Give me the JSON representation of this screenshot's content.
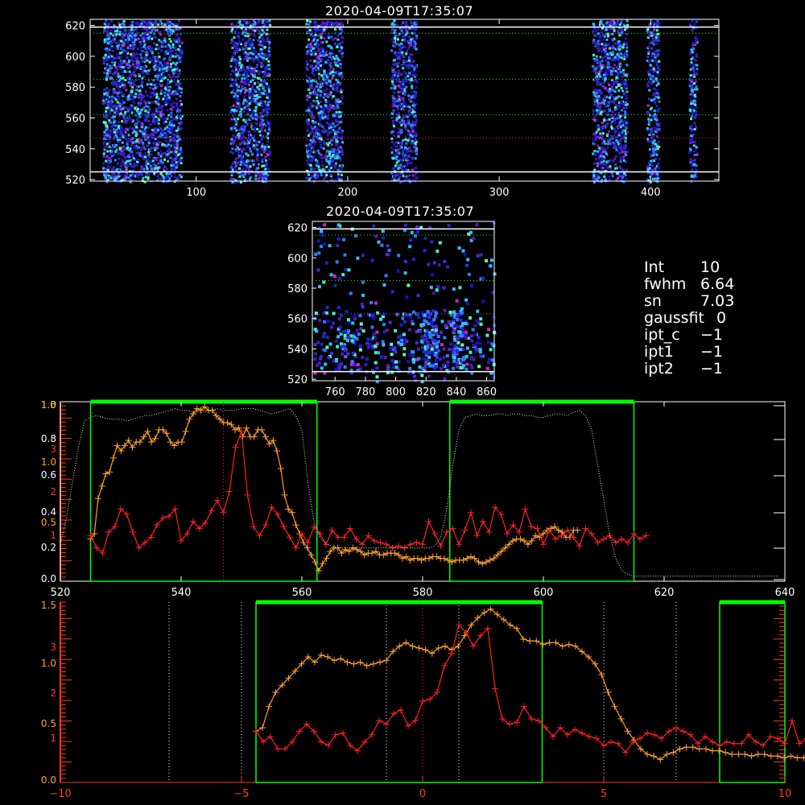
{
  "titles": {
    "top": "2020-04-09T17:35:07",
    "mid": "2020-04-09T17:35:07"
  },
  "info": {
    "lines": [
      {
        "label": "Int",
        "value": "10"
      },
      {
        "label": "fwhm",
        "value": "6.64"
      },
      {
        "label": "sn",
        "value": "7.03"
      },
      {
        "label": "gaussfit",
        "value": "0"
      },
      {
        "label": "ipt_c",
        "value": "−1"
      },
      {
        "label": "ipt1",
        "value": "−1"
      },
      {
        "label": "ipt2",
        "value": "−1"
      }
    ]
  },
  "colors": {
    "axes": "#ffffff",
    "green": "#00ff00",
    "red": "#ff2020",
    "orange": "#ffa030",
    "lightgreen": "#ccffcc",
    "red_axis": "#ff3b1f"
  },
  "chart_data": [
    {
      "type": "heatmap",
      "title": "2020-04-09T17:35:07",
      "xlim": [
        30,
        445
      ],
      "ylim": [
        519,
        624
      ],
      "x_ticks": [
        100,
        200,
        300,
        400
      ],
      "y_ticks": [
        520,
        540,
        560,
        580,
        600,
        620
      ],
      "active_x_bands": [
        [
          38,
          90
        ],
        [
          122,
          148
        ],
        [
          172,
          196
        ],
        [
          228,
          245
        ],
        [
          361,
          384
        ],
        [
          397,
          405
        ],
        [
          425,
          430
        ]
      ],
      "solid_y": [
        525,
        619
      ],
      "dotted_y_green": [
        562,
        585,
        615
      ],
      "dotted_y_red": [
        547
      ]
    },
    {
      "type": "heatmap",
      "title": "2020-04-09T17:35:07",
      "xlim": [
        745,
        865
      ],
      "ylim": [
        519,
        624
      ],
      "x_ticks": [
        760,
        780,
        800,
        820,
        840,
        860
      ],
      "y_ticks": [
        520,
        540,
        560,
        580,
        600,
        620
      ],
      "solid_y": [
        525,
        619
      ],
      "dotted_y_green": [
        585,
        615
      ],
      "dotted_y_blue": [
        563
      ]
    },
    {
      "type": "line",
      "xlim": [
        520,
        640
      ],
      "x_ticks": [
        520,
        540,
        560,
        580,
        600,
        620,
        640
      ],
      "y_ticks_white": [
        "0.0",
        "0.2",
        "0.4",
        "0.6",
        "0.8",
        "1.0"
      ],
      "y_ticks_orange": [
        "0.5",
        "1.0",
        "1.5"
      ],
      "y_ticks_red": [
        "1",
        "2",
        "3"
      ],
      "green_boxes": [
        [
          525,
          562.5
        ],
        [
          584.5,
          615
        ]
      ],
      "red_dotted_x": 547,
      "series": [
        {
          "color": "orange",
          "x0": 525,
          "dx": 0.63,
          "values": [
            0.23,
            0.26,
            0.46,
            0.53,
            0.6,
            0.61,
            0.69,
            0.76,
            0.73,
            0.76,
            0.79,
            0.75,
            0.78,
            0.78,
            0.81,
            0.84,
            0.78,
            0.8,
            0.85,
            0.85,
            0.83,
            0.78,
            0.76,
            0.78,
            0.78,
            0.84,
            0.91,
            0.94,
            0.97,
            0.96,
            0.98,
            0.96,
            0.96,
            0.93,
            0.91,
            0.89,
            0.89,
            0.88,
            0.85,
            0.86,
            0.81,
            0.86,
            0.81,
            0.81,
            0.85,
            0.85,
            0.81,
            0.77,
            0.79,
            0.73,
            0.63,
            0.48,
            0.4,
            0.38,
            0.31,
            0.26,
            0.21,
            0.18,
            0.14,
            0.1,
            0.05,
            0.09,
            0.12,
            0.16,
            0.18,
            0.18,
            0.15,
            0.17,
            0.16,
            0.18,
            0.17,
            0.16,
            0.14,
            0.15,
            0.15,
            0.16,
            0.14,
            0.14,
            0.15,
            0.15,
            0.15,
            0.14,
            0.12,
            0.13,
            0.11,
            0.12,
            0.12,
            0.11,
            0.12,
            0.12,
            0.13,
            0.13,
            0.12,
            0.12,
            0.11,
            0.1,
            0.11,
            0.11,
            0.11,
            0.12,
            0.13,
            0.12,
            0.1,
            0.09,
            0.1,
            0.11,
            0.12,
            0.14,
            0.16,
            0.18,
            0.2,
            0.22,
            0.23,
            0.23,
            0.22,
            0.2,
            0.22,
            0.25,
            0.24,
            0.26,
            0.28,
            0.29,
            0.3,
            0.28,
            0.27,
            0.24,
            0.24,
            0.28,
            0.28
          ]
        },
        {
          "color": "red",
          "x0": 525,
          "dx": 1.0,
          "values": [
            0.25,
            0.18,
            0.15,
            0.27,
            0.3,
            0.4,
            0.37,
            0.27,
            0.18,
            0.21,
            0.24,
            0.31,
            0.35,
            0.36,
            0.4,
            0.22,
            0.26,
            0.33,
            0.29,
            0.32,
            0.39,
            0.45,
            0.38,
            0.5,
            0.75,
            0.84,
            0.48,
            0.3,
            0.25,
            0.31,
            0.41,
            0.37,
            0.3,
            0.24,
            0.18,
            0.26,
            0.21,
            0.3,
            0.26,
            0.2,
            0.28,
            0.24,
            0.24,
            0.29,
            0.23,
            0.2,
            0.25,
            0.22,
            0.21,
            0.2,
            0.18,
            0.19,
            0.18,
            0.2,
            0.21,
            0.2,
            0.33,
            0.26,
            0.19,
            0.27,
            0.29,
            0.2,
            0.28,
            0.38,
            0.25,
            0.33,
            0.27,
            0.41,
            0.37,
            0.26,
            0.31,
            0.27,
            0.4,
            0.3,
            0.29,
            0.2,
            0.28,
            0.23,
            0.25,
            0.28,
            0.24,
            0.19,
            0.29,
            0.26,
            0.21,
            0.23,
            0.25,
            0.21,
            0.23,
            0.21,
            0.26,
            0.23,
            0.25
          ]
        },
        {
          "color": "lightgreen",
          "style": "dotted",
          "x0": 520,
          "dx": 1.0,
          "values": [
            0.2,
            0.35,
            0.55,
            0.75,
            0.9,
            0.92,
            0.93,
            0.92,
            0.91,
            0.91,
            0.91,
            0.9,
            0.91,
            0.92,
            0.93,
            0.93,
            0.94,
            0.95,
            0.96,
            0.97,
            0.96,
            0.96,
            0.95,
            0.95,
            0.95,
            0.96,
            0.97,
            0.96,
            0.96,
            0.96,
            0.97,
            0.97,
            0.97,
            0.96,
            0.95,
            0.94,
            0.95,
            0.96,
            0.97,
            0.93,
            0.85,
            0.55,
            0.33,
            0.24,
            0.2,
            0.19,
            0.18,
            0.18,
            0.18,
            0.18,
            0.18,
            0.18,
            0.18,
            0.18,
            0.18,
            0.18,
            0.18,
            0.18,
            0.18,
            0.18,
            0.18,
            0.18,
            0.19,
            0.24,
            0.4,
            0.65,
            0.85,
            0.92,
            0.93,
            0.94,
            0.93,
            0.93,
            0.94,
            0.94,
            0.93,
            0.94,
            0.94,
            0.93,
            0.93,
            0.92,
            0.92,
            0.93,
            0.94,
            0.94,
            0.93,
            0.95,
            0.96,
            0.93,
            0.85,
            0.65,
            0.45,
            0.25,
            0.12,
            0.05,
            0.03,
            0.02,
            0.02,
            0.02,
            0.02,
            0.02,
            0.02,
            0.02,
            0.02,
            0.02,
            0.02,
            0.02,
            0.02,
            0.02,
            0.02,
            0.02,
            0.02,
            0.02,
            0.02,
            0.02,
            0.02,
            0.02,
            0.02,
            0.02,
            0.02,
            0.02
          ]
        }
      ]
    },
    {
      "type": "line",
      "xlim": [
        -10,
        10
      ],
      "x_ticks": [
        -10,
        -5,
        0,
        5,
        10
      ],
      "y_ticks_orange": [
        "0.0",
        "0.5",
        "1.0",
        "1.5"
      ],
      "y_ticks_red": [
        "1",
        "2",
        "3"
      ],
      "green_boxes": [
        [
          -4.6,
          3.3
        ],
        [
          8.2,
          10.0
        ]
      ],
      "white_dotted_x": [
        -7,
        -5,
        -1,
        1,
        5,
        7
      ],
      "red_dotted_x": 0,
      "series": [
        {
          "color": "orange",
          "x0": -4.6,
          "dx": 0.18,
          "values": [
            0.28,
            0.3,
            0.42,
            0.5,
            0.54,
            0.58,
            0.62,
            0.66,
            0.7,
            0.67,
            0.71,
            0.7,
            0.68,
            0.69,
            0.67,
            0.66,
            0.67,
            0.65,
            0.66,
            0.67,
            0.68,
            0.73,
            0.76,
            0.78,
            0.76,
            0.75,
            0.74,
            0.72,
            0.75,
            0.76,
            0.74,
            0.76,
            0.82,
            0.88,
            0.92,
            0.95,
            0.97,
            0.94,
            0.91,
            0.88,
            0.86,
            0.8,
            0.79,
            0.79,
            0.77,
            0.78,
            0.78,
            0.76,
            0.77,
            0.76,
            0.73,
            0.7,
            0.66,
            0.6,
            0.5,
            0.42,
            0.35,
            0.28,
            0.23,
            0.18,
            0.15,
            0.14,
            0.12,
            0.15,
            0.16,
            0.18,
            0.19,
            0.19,
            0.18,
            0.18,
            0.17,
            0.17,
            0.16,
            0.15,
            0.15,
            0.15,
            0.14,
            0.15,
            0.15,
            0.14,
            0.14,
            0.13,
            0.14,
            0.13,
            0.13,
            0.14,
            0.13,
            0.13,
            0.14,
            0.15,
            0.14,
            0.14,
            0.13,
            0.13,
            0.14,
            0.14
          ]
        },
        {
          "color": "red",
          "x0": -4.6,
          "dx": 0.2,
          "values": [
            0.28,
            0.22,
            0.25,
            0.18,
            0.18,
            0.22,
            0.28,
            0.32,
            0.28,
            0.22,
            0.2,
            0.26,
            0.27,
            0.2,
            0.17,
            0.22,
            0.26,
            0.34,
            0.32,
            0.38,
            0.4,
            0.31,
            0.34,
            0.45,
            0.46,
            0.5,
            0.65,
            0.72,
            0.88,
            0.84,
            0.76,
            0.82,
            0.86,
            0.52,
            0.35,
            0.32,
            0.33,
            0.42,
            0.35,
            0.34,
            0.3,
            0.25,
            0.3,
            0.26,
            0.29,
            0.27,
            0.25,
            0.24,
            0.2,
            0.22,
            0.21,
            0.16,
            0.22,
            0.24,
            0.27,
            0.26,
            0.24,
            0.28,
            0.3,
            0.28,
            0.26,
            0.21,
            0.25,
            0.22,
            0.2,
            0.22,
            0.21,
            0.21,
            0.26,
            0.22,
            0.2,
            0.25,
            0.24,
            0.21,
            0.34,
            0.21,
            0.24,
            0.28,
            0.23,
            0.24,
            0.31,
            0.34,
            0.42,
            0.4,
            0.43
          ]
        }
      ]
    }
  ]
}
